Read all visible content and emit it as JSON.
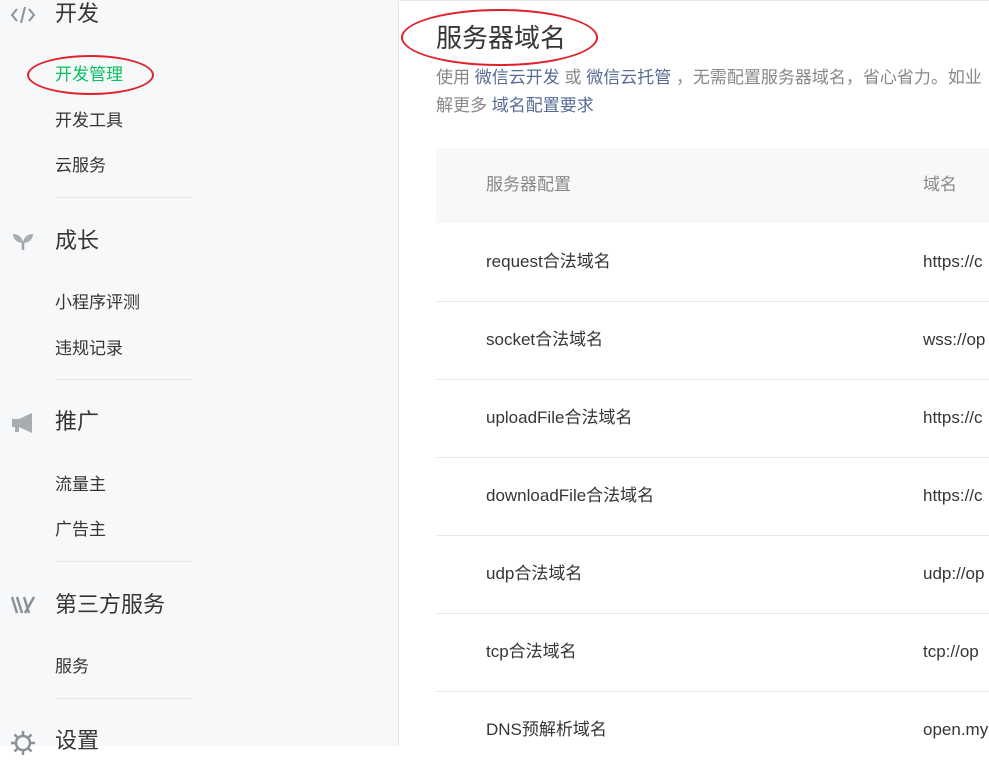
{
  "sidebar": {
    "groups": [
      {
        "title": "开发",
        "icon": "code-icon",
        "items": [
          "开发管理",
          "开发工具",
          "云服务"
        ]
      },
      {
        "title": "成长",
        "icon": "sprout-icon",
        "items": [
          "小程序评测",
          "违规记录"
        ]
      },
      {
        "title": "推广",
        "icon": "megaphone-icon",
        "items": [
          "流量主",
          "广告主"
        ]
      },
      {
        "title": "第三方服务",
        "icon": "third-party-icon",
        "items": [
          "服务"
        ]
      },
      {
        "title": "设置",
        "icon": "gear-icon",
        "items": []
      }
    ],
    "active_item": "开发管理"
  },
  "main": {
    "title": "服务器域名",
    "desc": {
      "prefix": "使用",
      "link1": "微信云开发",
      "mid": "或",
      "link2": "微信云托管",
      "suffix": "，无需配置服务器域名，省心省力。如业",
      "line2_prefix": "解更多",
      "link3": "域名配置要求"
    },
    "table": {
      "headers": [
        "服务器配置",
        "域名"
      ],
      "rows": [
        {
          "name": "request合法域名",
          "domain": "https://c"
        },
        {
          "name": "socket合法域名",
          "domain": "wss://op"
        },
        {
          "name": "uploadFile合法域名",
          "domain": "https://c"
        },
        {
          "name": "downloadFile合法域名",
          "domain": "https://c"
        },
        {
          "name": "udp合法域名",
          "domain": "udp://op"
        },
        {
          "name": "tcp合法域名",
          "domain": "tcp://op"
        },
        {
          "name": "DNS预解析域名",
          "domain": "open.my"
        }
      ]
    }
  },
  "colors": {
    "active": "#07c160",
    "link": "#576b95",
    "annotation": "#e0212a"
  }
}
